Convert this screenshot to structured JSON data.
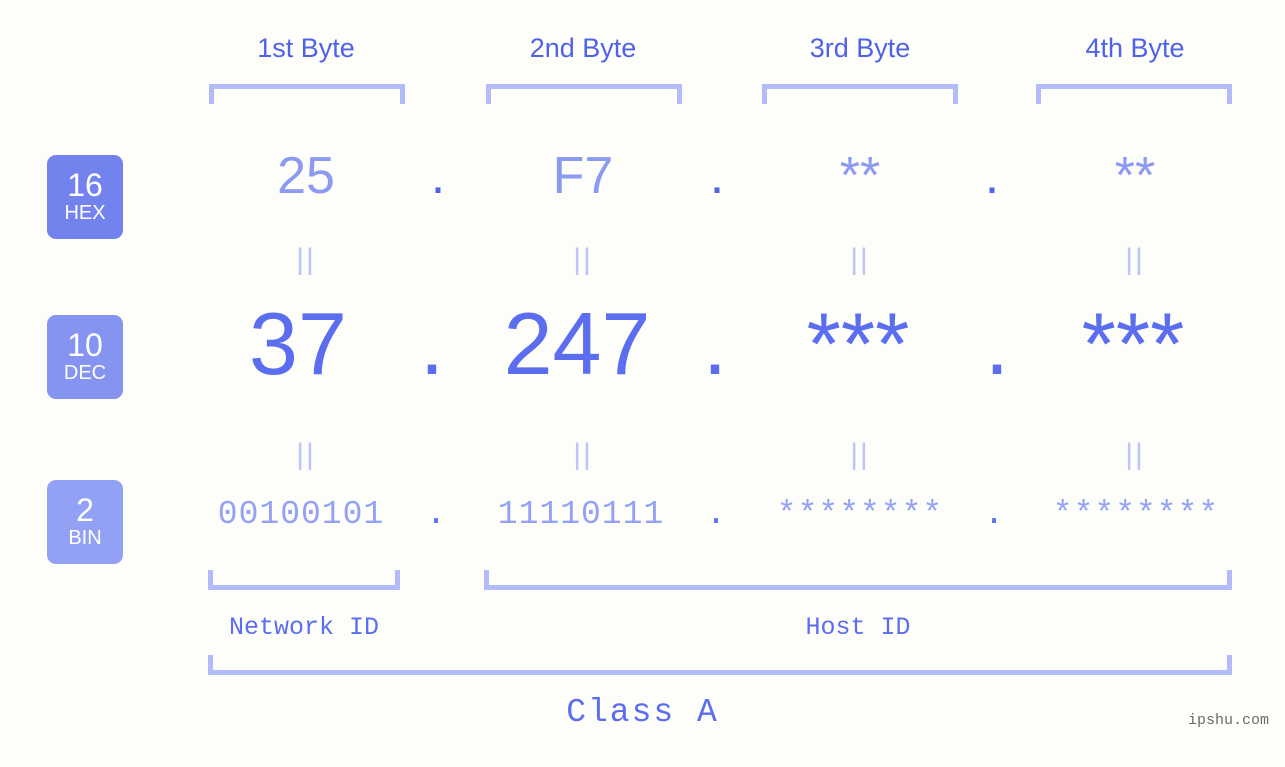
{
  "background_color": "#fdfdf9",
  "accent_colors": {
    "strong_blue": "#5c6ef0",
    "mid_blue": "#8c9af2",
    "light_blue": "#b3bcf9",
    "pale_blue": "#bcc4fa"
  },
  "byte_headers": [
    {
      "label": "1st Byte"
    },
    {
      "label": "2nd Byte"
    },
    {
      "label": "3rd Byte"
    },
    {
      "label": "4th Byte"
    }
  ],
  "base_badges": [
    {
      "number": "16",
      "abbr": "HEX",
      "color": "#7383ee"
    },
    {
      "number": "10",
      "abbr": "DEC",
      "color": "#8593f1"
    },
    {
      "number": "2",
      "abbr": "BIN",
      "color": "#93a1f5"
    }
  ],
  "rows": {
    "hex": {
      "values": [
        "25",
        "F7",
        "**",
        "**"
      ],
      "separators": [
        ".",
        ".",
        "."
      ]
    },
    "dec": {
      "values": [
        "37",
        "247",
        "***",
        "***"
      ],
      "separators": [
        ".",
        ".",
        "."
      ]
    },
    "bin": {
      "values": [
        "00100101",
        "11110111",
        "********",
        "********"
      ],
      "separators": [
        ".",
        ".",
        "."
      ]
    }
  },
  "equals_markers": {
    "hex_to_dec": [
      "||",
      "||",
      "||",
      "||"
    ],
    "dec_to_bin": [
      "||",
      "||",
      "||",
      "||"
    ]
  },
  "id_sections": [
    {
      "label": "Network ID"
    },
    {
      "label": "Host ID"
    }
  ],
  "class_label": "Class A",
  "watermark": "ipshu.com"
}
